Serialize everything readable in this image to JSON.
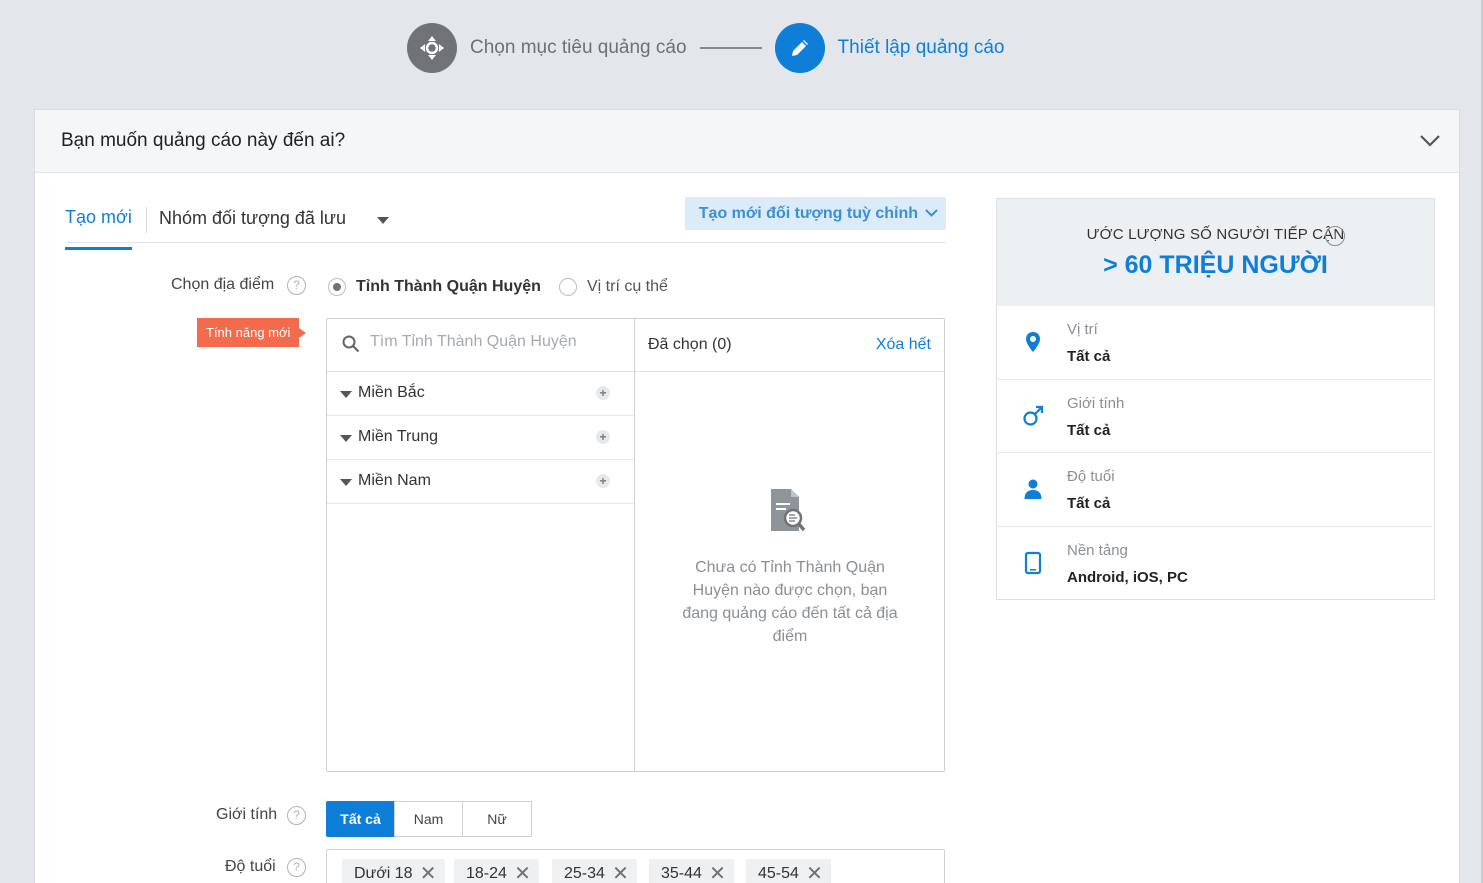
{
  "stepper": {
    "step1_label": "Chọn mục tiêu quảng cáo",
    "step2_label": "Thiết lập quảng cáo"
  },
  "card": {
    "title": "Bạn muốn quảng cáo này đến ai?"
  },
  "tabs": {
    "new_label": "Tạo mới",
    "saved_label": "Nhóm đối tượng đã lưu",
    "custom_button": "Tạo mới đối tượng tuỳ chỉnh"
  },
  "location": {
    "label": "Chọn địa điểm",
    "option_province": "Tỉnh Thành Quận Huyện",
    "option_specific": "Vị trí cụ thể",
    "selected_option": "Tỉnh Thành Quận Huyện",
    "new_badge": "Tính năng mới",
    "search_placeholder": "Tìm Tỉnh Thành Quận Huyện",
    "regions": [
      "Miền Bắc",
      "Miền Trung",
      "Miền Nam"
    ],
    "selected_header": "Đã chọn (0)",
    "clear_all": "Xóa hết",
    "empty_message": "Chưa có Tỉnh Thành Quận Huyện nào được chọn, bạn đang quảng cáo đến tất cả địa điểm"
  },
  "gender": {
    "label": "Giới tính",
    "options": [
      "Tất cả",
      "Nam",
      "Nữ"
    ],
    "selected": "Tất cả"
  },
  "age": {
    "label": "Độ tuổi",
    "chips": [
      "Dưới 18",
      "18-24",
      "25-34",
      "35-44",
      "45-54"
    ]
  },
  "estimate": {
    "title": "ƯỚC LƯỢNG SỐ NGƯỜI TIẾP CẬN",
    "value": "> 60 TRIỆU NGƯỜI",
    "items": [
      {
        "label": "Vị trí",
        "value": "Tất cả",
        "icon": "location-pin-icon"
      },
      {
        "label": "Giới tính",
        "value": "Tất cả",
        "icon": "male-symbol-icon"
      },
      {
        "label": "Độ tuổi",
        "value": "Tất cả",
        "icon": "person-icon"
      },
      {
        "label": "Nền tảng",
        "value": "Android, iOS, PC",
        "icon": "tablet-icon"
      }
    ]
  },
  "colors": {
    "accent": "#0e7ed9",
    "badge": "#f36b4c",
    "step_done": "#6f7378"
  }
}
